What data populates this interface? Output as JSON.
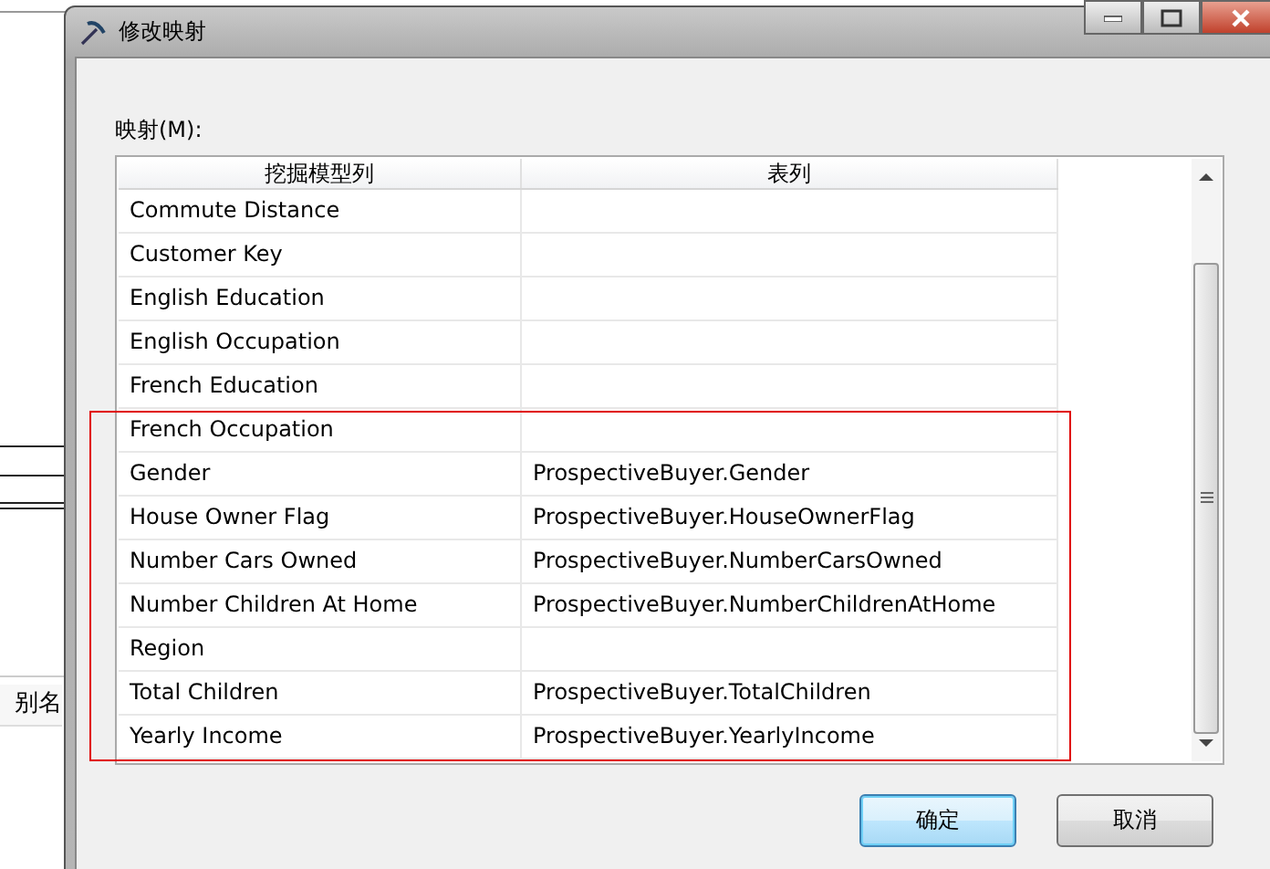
{
  "background": {
    "column_header": "别名"
  },
  "window": {
    "title": "修改映射"
  },
  "mapping": {
    "label": "映射(M):",
    "columns": [
      "挖掘模型列",
      "表列"
    ],
    "rows": [
      {
        "model_column": "Commute Distance",
        "table_column": ""
      },
      {
        "model_column": "Customer Key",
        "table_column": ""
      },
      {
        "model_column": "English Education",
        "table_column": ""
      },
      {
        "model_column": "English Occupation",
        "table_column": ""
      },
      {
        "model_column": "French Education",
        "table_column": ""
      },
      {
        "model_column": "French Occupation",
        "table_column": ""
      },
      {
        "model_column": "Gender",
        "table_column": "ProspectiveBuyer.Gender"
      },
      {
        "model_column": "House Owner Flag",
        "table_column": "ProspectiveBuyer.HouseOwnerFlag"
      },
      {
        "model_column": "Number Cars Owned",
        "table_column": "ProspectiveBuyer.NumberCarsOwned"
      },
      {
        "model_column": "Number Children At Home",
        "table_column": "ProspectiveBuyer.NumberChildrenAtHome"
      },
      {
        "model_column": "Region",
        "table_column": ""
      },
      {
        "model_column": "Total Children",
        "table_column": "ProspectiveBuyer.TotalChildren"
      },
      {
        "model_column": "Yearly Income",
        "table_column": "ProspectiveBuyer.YearlyIncome"
      }
    ]
  },
  "annotation": {
    "kind": "frame"
  },
  "buttons": [
    {
      "label": "确定",
      "kind": "default"
    },
    {
      "label": "取消",
      "kind": "normal"
    }
  ]
}
